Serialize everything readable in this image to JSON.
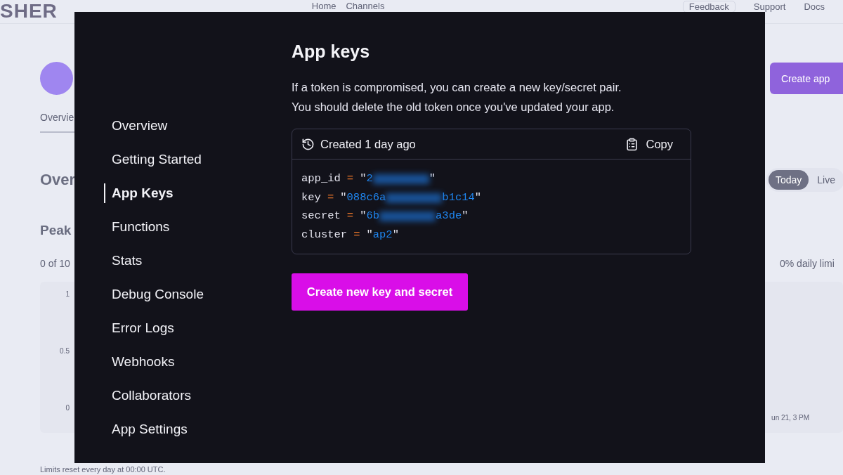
{
  "background_page": {
    "logo": "SHER",
    "breadcrumb": [
      "Home",
      "Channels"
    ],
    "header_links": [
      "Feedback",
      "Support",
      "Docs"
    ],
    "create_button": "Create app",
    "tab": "Overvie",
    "section_heading": "Over",
    "range_toggle": [
      {
        "label": "Today",
        "selected": true
      },
      {
        "label": "Live",
        "selected": false
      }
    ],
    "peak_heading": "Peak",
    "usage": "0 of 10",
    "daily_limit": "0% daily limi",
    "chart_ticks": [
      "1",
      "0.5",
      "0"
    ],
    "chart_date": "un 21, 3 PM",
    "footnote": "Limits reset every day at 00:00 UTC."
  },
  "modal": {
    "nav": [
      {
        "label": "Overview",
        "selected": false
      },
      {
        "label": "Getting Started",
        "selected": false
      },
      {
        "label": "App Keys",
        "selected": true
      },
      {
        "label": "Functions",
        "selected": false
      },
      {
        "label": "Stats",
        "selected": false
      },
      {
        "label": "Debug Console",
        "selected": false
      },
      {
        "label": "Error Logs",
        "selected": false
      },
      {
        "label": "Webhooks",
        "selected": false
      },
      {
        "label": "Collaborators",
        "selected": false
      },
      {
        "label": "App Settings",
        "selected": false
      }
    ],
    "title": "App keys",
    "description": [
      "If a token is compromised, you can create a new key/secret pair.",
      "You should delete the old token once you've updated your app."
    ],
    "credentials": {
      "created": "Created 1 day ago",
      "copy": "Copy",
      "lines": [
        {
          "name": "app_id",
          "operator": "=",
          "open_quote": "\"",
          "value_start": "2",
          "redacted": true,
          "close_quote": "\""
        },
        {
          "name": "key",
          "operator": "=",
          "open_quote": "\"",
          "value_start": "088c6a",
          "redacted": true,
          "value_end": "b1c14",
          "close_quote": "\""
        },
        {
          "name": "secret",
          "operator": "=",
          "open_quote": "\"",
          "value_start": "6b",
          "redacted": true,
          "value_end": "a3de",
          "close_quote": "\""
        },
        {
          "name": "cluster",
          "operator": "=",
          "open_quote": "\"",
          "value_start": "ap2",
          "redacted": false,
          "close_quote": "\""
        }
      ]
    },
    "button": "Create new key and secret"
  }
}
